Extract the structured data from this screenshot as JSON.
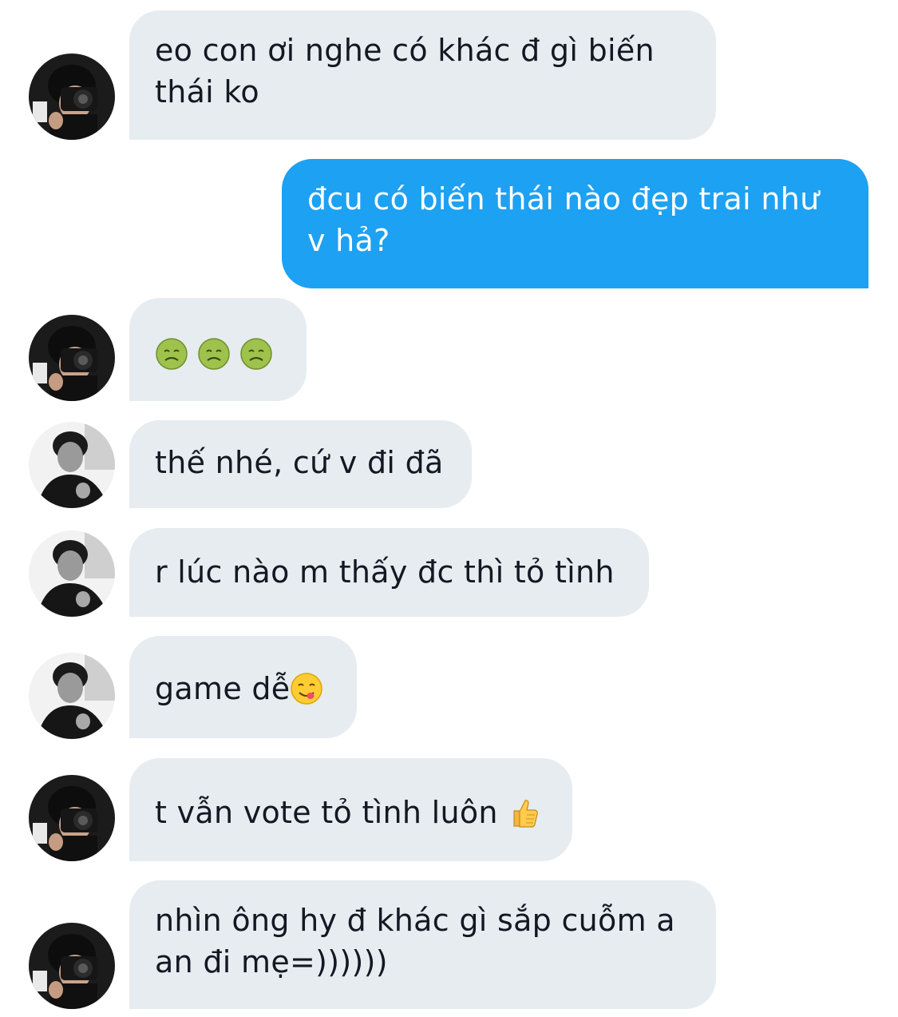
{
  "messages": [
    {
      "side": "in",
      "avatar": "avatar-photographer",
      "text": "eo con ơi nghe có khác đ gì biến thái ko"
    },
    {
      "side": "out",
      "text": "đcu có biến thái nào đẹp trai như v hả?"
    },
    {
      "side": "in",
      "avatar": "avatar-photographer",
      "emojis": [
        "nauseated-face-emoji",
        "nauseated-face-emoji",
        "nauseated-face-emoji"
      ]
    },
    {
      "side": "in",
      "avatar": "avatar-portrait-bw",
      "text": "thế nhé, cứ v đi đã"
    },
    {
      "side": "in",
      "avatar": "avatar-portrait-bw",
      "text": "r lúc nào m thấy đc thì tỏ tình"
    },
    {
      "side": "in",
      "avatar": "avatar-portrait-bw",
      "text": "game dễ",
      "trailing_emoji": "yum-face-emoji"
    },
    {
      "side": "in",
      "avatar": "avatar-photographer",
      "text": "t vẫn vote tỏ tình luôn ",
      "trailing_emoji": "thumbs-up-emoji"
    },
    {
      "side": "in",
      "avatar": "avatar-photographer",
      "text": "nhìn ông hy đ khác gì sắp cuỗm a an đi mẹ=))))))"
    }
  ],
  "colors": {
    "incoming_bubble": "#e6ecf0",
    "outgoing_bubble": "#1da1f2",
    "incoming_text": "#141823",
    "outgoing_text": "#ffffff"
  }
}
